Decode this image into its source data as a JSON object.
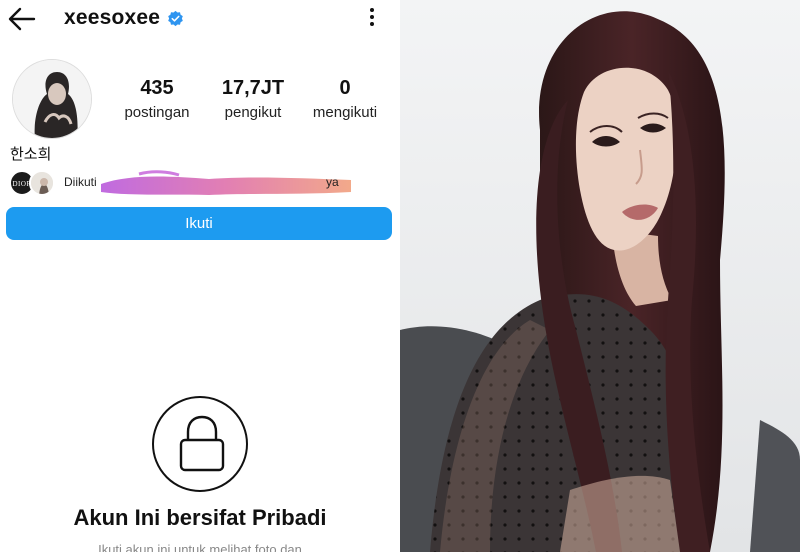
{
  "profile": {
    "username": "xeesoxee",
    "verified": true,
    "display_name": "한소희",
    "stats": [
      {
        "value": "435",
        "label": "postingan"
      },
      {
        "value": "17,7JT",
        "label": "pengikut"
      },
      {
        "value": "0",
        "label": "mengikuti"
      }
    ],
    "followed_by": {
      "prefix": "Diikuti",
      "suffix": "ya",
      "mini_avatar_1_text": "DIOR"
    },
    "follow_button": "Ikuti",
    "private": {
      "title": "Akun Ini bersifat Pribadi",
      "subtitle": "Ikuti akun ini untuk melihat foto dan"
    }
  },
  "icons": {
    "back": "arrow-left-icon",
    "verified": "verified-badge-icon",
    "more": "more-vertical-icon",
    "lock": "lock-icon"
  },
  "colors": {
    "accent": "#1d9bf0",
    "verified": "#2f95f0"
  }
}
